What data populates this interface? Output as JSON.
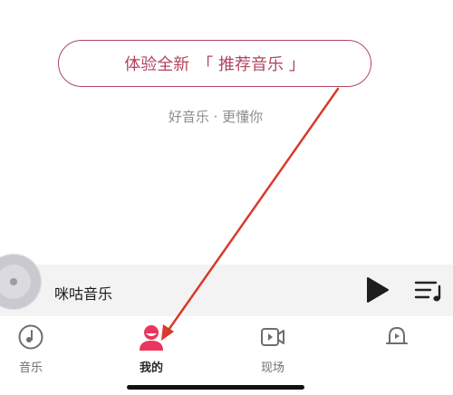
{
  "promo": {
    "prefix": "体验全新",
    "cta": "「 推荐音乐 」"
  },
  "subtitle": "好音乐 · 更懂你",
  "player": {
    "track_title": "咪咕音乐",
    "play_icon": "play-icon",
    "playlist_icon": "playlist-icon"
  },
  "tabs": [
    {
      "label": "音乐",
      "icon": "music-disc-icon",
      "active": false
    },
    {
      "label": "我的",
      "icon": "profile-icon",
      "active": true
    },
    {
      "label": "现场",
      "icon": "video-icon",
      "active": false
    },
    {
      "label": "",
      "icon": "bell-icon",
      "active": false
    }
  ],
  "colors": {
    "accent": "#e8365d",
    "pill_border": "#b04660",
    "annotation_arrow": "#d93a2b"
  }
}
